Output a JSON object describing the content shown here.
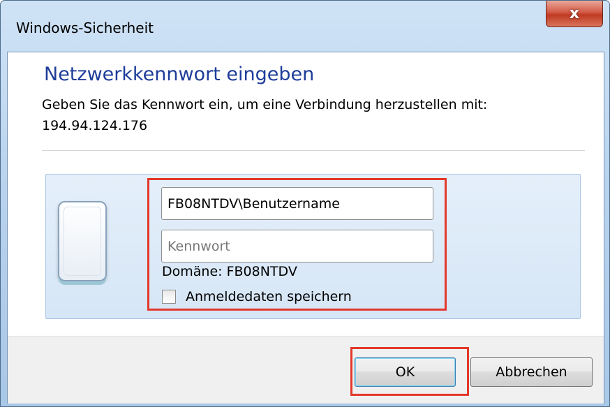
{
  "window": {
    "title": "Windows-Sicherheit",
    "close_label": "x"
  },
  "dialog": {
    "heading": "Netzwerkkennwort eingeben",
    "description": "Geben Sie das Kennwort ein, um eine Verbindung herzustellen mit:",
    "target": "194.94.124.176"
  },
  "credentials": {
    "username_value": "FB08NTDV\\Benutzername",
    "password_placeholder": "Kennwort",
    "domain_text": "Domäne: FB08NTDV",
    "remember_label": "Anmeldedaten speichern",
    "remember_checked": false
  },
  "buttons": {
    "ok_label": "OK",
    "cancel_label": "Abbrechen"
  },
  "colors": {
    "highlight": "#e4382a",
    "heading": "#1e3d9a",
    "close_button": "#c03a22"
  }
}
